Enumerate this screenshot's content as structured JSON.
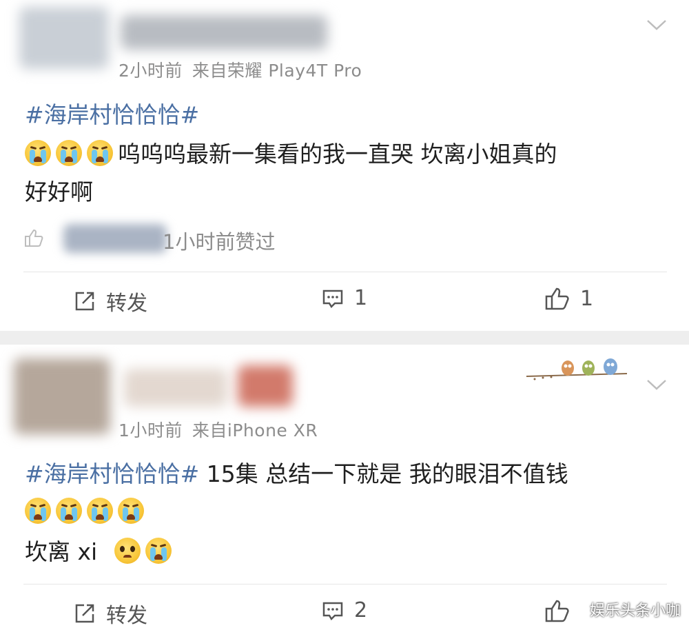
{
  "posts": [
    {
      "meta": {
        "time": "2小时前",
        "source": "来自荣耀 Play4T Pro"
      },
      "hashtag": "#海岸村恰恰恰#",
      "text_line1": "呜呜呜最新一集看的我一直哭  坎离小姐真的",
      "text_line2": "好好啊",
      "liked_notice": "1小时前赞过",
      "actions": {
        "repost": "转发",
        "comments": "1",
        "likes": "1"
      }
    },
    {
      "meta": {
        "time": "1小时前",
        "source": "来自iPhone XR"
      },
      "hashtag": "#海岸村恰恰恰#",
      "text_after_hashtag": " 15集 总结一下就是  我的眼泪不值钱",
      "text_line3": "坎离 xi",
      "actions": {
        "repost": "转发",
        "comments": "2",
        "likes": ""
      }
    }
  ],
  "watermark": "娱乐头条小咖",
  "icons": [
    "chevron-down-icon",
    "like-icon",
    "repost-icon",
    "comment-icon",
    "crying-emoji",
    "sad-emoji",
    "owl-decoration"
  ],
  "colors": {
    "hashtag": "#4a6fa3",
    "meta": "#8c8c8c",
    "separator": "#eeeeee"
  }
}
